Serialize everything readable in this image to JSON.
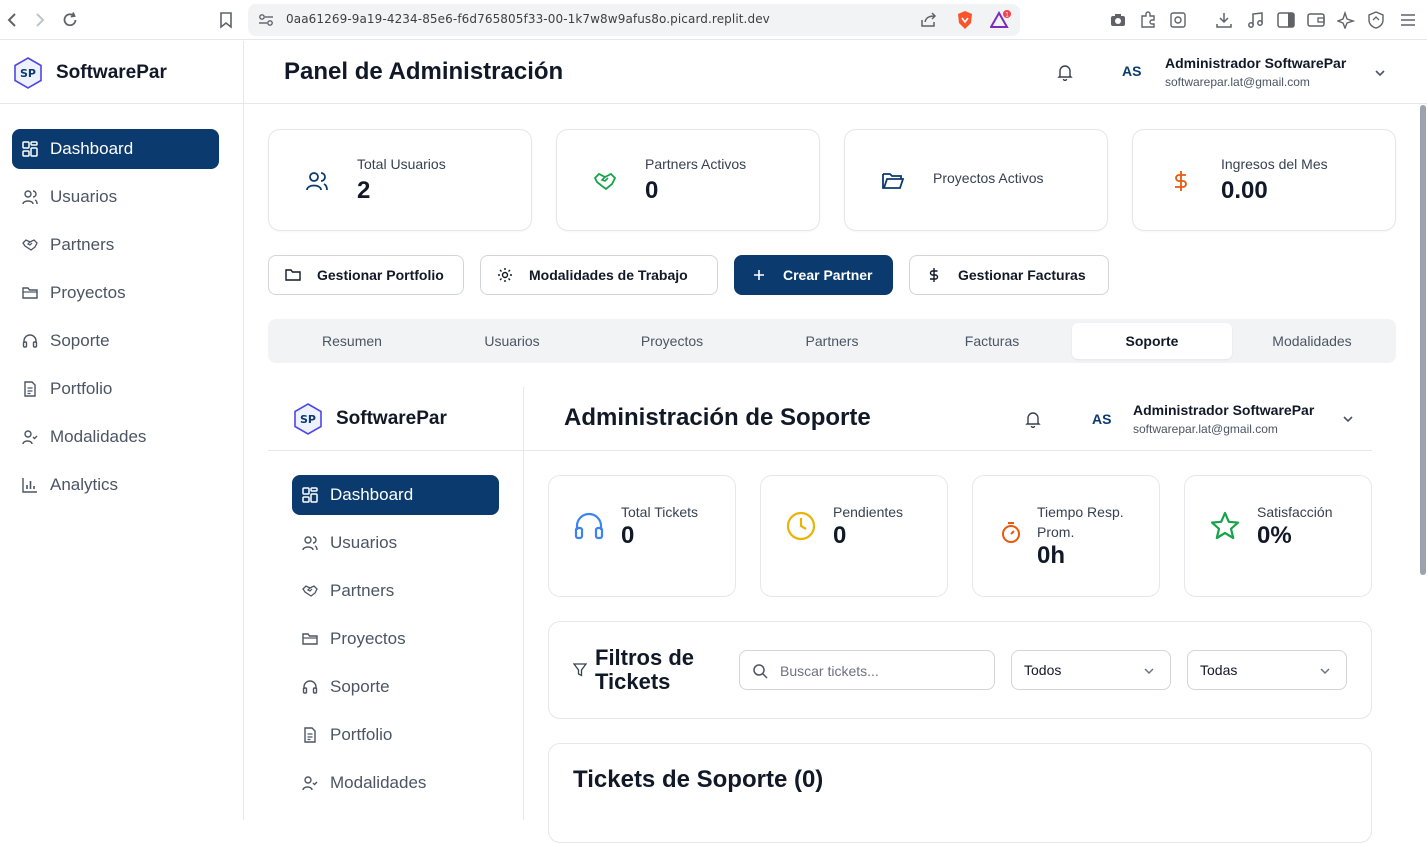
{
  "browser": {
    "url": "0aa61269-9a19-4234-85e6-f6d765805f33-00-1k7w8w9afus8o.picard.replit.dev"
  },
  "brand": {
    "name": "SoftwarePar"
  },
  "sidebar": {
    "items": [
      {
        "label": "Dashboard",
        "icon": "dashboard-icon"
      },
      {
        "label": "Usuarios",
        "icon": "users-icon"
      },
      {
        "label": "Partners",
        "icon": "handshake-icon"
      },
      {
        "label": "Proyectos",
        "icon": "folder-icon"
      },
      {
        "label": "Soporte",
        "icon": "headphones-icon"
      },
      {
        "label": "Portfolio",
        "icon": "document-icon"
      },
      {
        "label": "Modalidades",
        "icon": "user-check-icon"
      },
      {
        "label": "Analytics",
        "icon": "bar-chart-icon"
      }
    ]
  },
  "header": {
    "title": "Panel de Administración",
    "avatar_initials": "AS",
    "user_name": "Administrador SoftwarePar",
    "user_email": "softwarepar.lat@gmail.com"
  },
  "stats": [
    {
      "label": "Total Usuarios",
      "value": "2",
      "color": "#0b3a6f"
    },
    {
      "label": "Partners Activos",
      "value": "0",
      "color": "#16a34a"
    },
    {
      "label": "Proyectos Activos",
      "value": "",
      "color": "#0b3a6f"
    },
    {
      "label": "Ingresos del Mes",
      "value": "0.00",
      "color": "#ea580c"
    }
  ],
  "actions": [
    {
      "label": "Gestionar Portfolio"
    },
    {
      "label": "Modalidades de Trabajo"
    },
    {
      "label": "Crear Partner"
    },
    {
      "label": "Gestionar Facturas"
    }
  ],
  "tabs": [
    {
      "label": "Resumen"
    },
    {
      "label": "Usuarios"
    },
    {
      "label": "Proyectos"
    },
    {
      "label": "Partners"
    },
    {
      "label": "Facturas"
    },
    {
      "label": "Soporte"
    },
    {
      "label": "Modalidades"
    }
  ],
  "active_tab": "Soporte",
  "inner": {
    "brand": "SoftwarePar",
    "sidebar": [
      {
        "label": "Dashboard"
      },
      {
        "label": "Usuarios"
      },
      {
        "label": "Partners"
      },
      {
        "label": "Proyectos"
      },
      {
        "label": "Soporte"
      },
      {
        "label": "Portfolio"
      },
      {
        "label": "Modalidades"
      }
    ],
    "title": "Administración de Soporte",
    "avatar_initials": "AS",
    "user_name": "Administrador SoftwarePar",
    "user_email": "softwarepar.lat@gmail.com",
    "cards": [
      {
        "label": "Total Tickets",
        "value": "0",
        "color": "#3b82f6"
      },
      {
        "label": "Pendientes",
        "value": "0",
        "color": "#eab308"
      },
      {
        "label": "Tiempo Resp. Prom.",
        "value": "0h",
        "color": "#ea580c"
      },
      {
        "label": "Satisfacción",
        "value": "0%",
        "color": "#16a34a"
      }
    ],
    "filters": {
      "title": "Filtros de Tickets",
      "search_placeholder": "Buscar tickets...",
      "select1": "Todos",
      "select2": "Todas"
    },
    "tickets_title": "Tickets de Soporte (0)"
  },
  "colors": {
    "primary": "#0b3a6f"
  }
}
